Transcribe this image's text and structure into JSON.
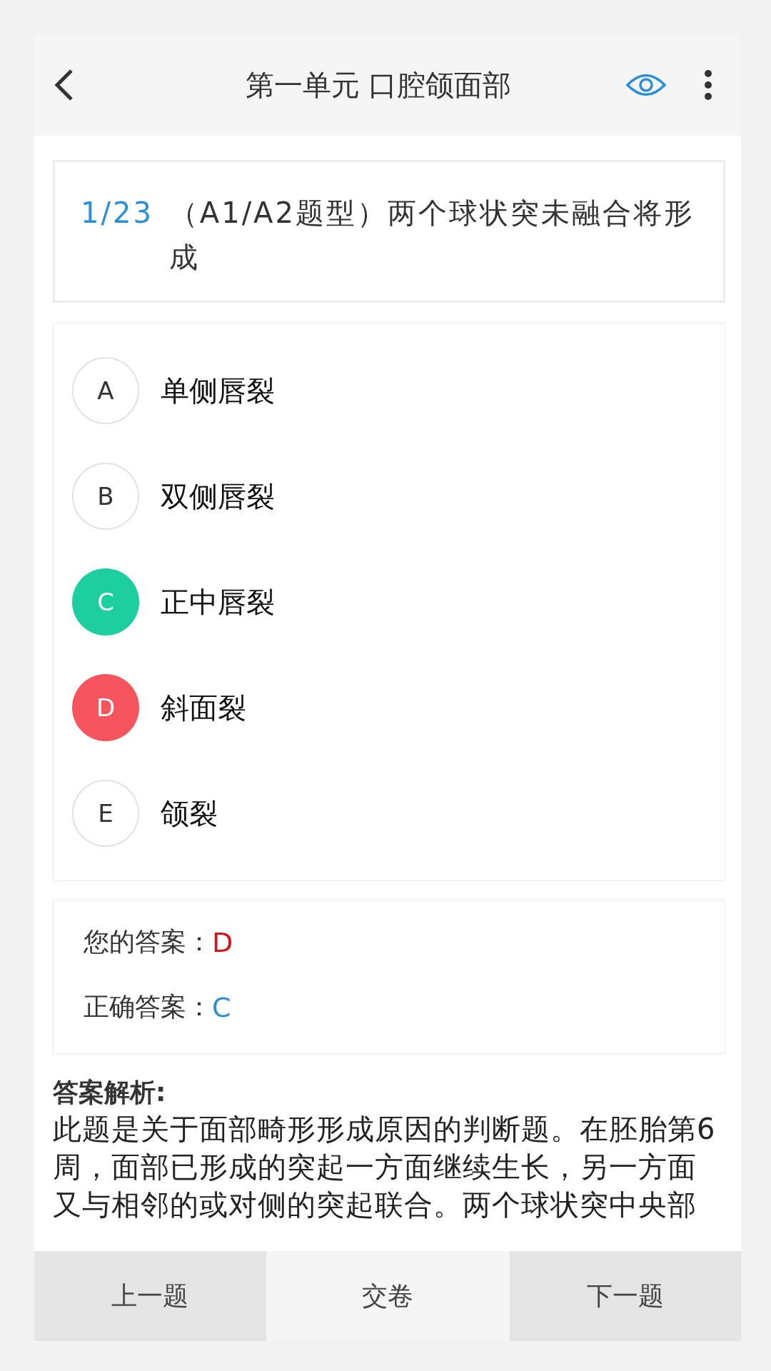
{
  "header": {
    "title": "第一单元 口腔颌面部"
  },
  "question": {
    "number": "1/23",
    "text": "（A1/A2题型）两个球状突未融合将形成"
  },
  "options": [
    {
      "letter": "A",
      "text": "单侧唇裂",
      "selected": false,
      "correct": false
    },
    {
      "letter": "B",
      "text": "双侧唇裂",
      "selected": false,
      "correct": false
    },
    {
      "letter": "C",
      "text": "正中唇裂",
      "selected": false,
      "correct": true
    },
    {
      "letter": "D",
      "text": "斜面裂",
      "selected": true,
      "correct": false
    },
    {
      "letter": "E",
      "text": "颌裂",
      "selected": false,
      "correct": false
    }
  ],
  "answers": [
    {
      "label": "您的答案：",
      "value": "D",
      "kind": "yours"
    },
    {
      "label": "正确答案：",
      "value": "C",
      "kind": "correct"
    }
  ],
  "analysis": {
    "heading": "答案解析:",
    "text": "此题是关于面部畸形形成原因的判断题。在胚胎第6周，面部已形成的突起一方面继续生长，另一方面又与相邻的或对侧的突起联合。两个球状突中央部"
  },
  "buttons": [
    {
      "label": "上一题",
      "kind": "nav"
    },
    {
      "label": "交卷",
      "kind": "submit"
    },
    {
      "label": "下一题",
      "kind": "nav"
    }
  ]
}
